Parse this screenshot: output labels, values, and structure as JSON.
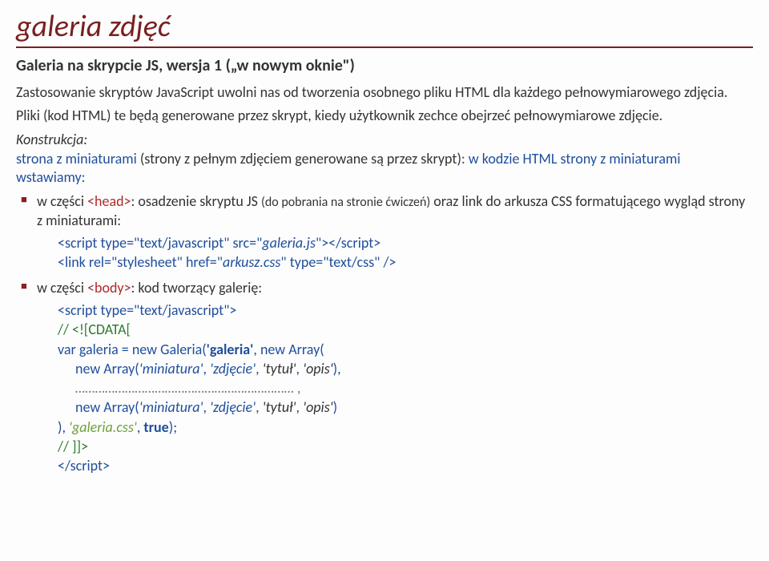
{
  "title": "galeria zdjęć",
  "subtitle": "Galeria na skrypcie JS, wersja 1 („w nowym oknie\")",
  "para1": "Zastosowanie skryptów JavaScript uwolni nas od tworzenia osobnego pliku HTML dla każdego pełnowymiarowego zdjęcia.",
  "para2": "Pliki (kod HTML) te będą generowane przez skrypt, kiedy użytkownik zechce obejrzeć pełnowymiarowe zdjęcie.",
  "konstrukcja": "Konstrukcja:",
  "strona_a": "strona z miniaturami ",
  "strona_b": "(strony z pełnym zdjęciem generowane są przez skrypt)",
  "strona_c": ": w kodzie HTML strony z miniaturami wstawiamy:",
  "li1_a": "w części ",
  "li1_head": "<head>",
  "li1_b": ": osadzenie skryptu JS ",
  "li1_paren": "(do pobrania na stronie ćwiczeń)",
  "li1_c": " oraz link do arkusza CSS formatującego wygląd strony z miniaturami:",
  "code1_a": "<script type=\"text/javascript\" src=\"",
  "code1_src": "galeria.js",
  "code1_b": "\"></scr",
  "code1_c": "ipt>",
  "code2_a": "<link rel=\"stylesheet\" href=\"",
  "code2_href": "arkusz.css",
  "code2_b": "\" type=\"text/css\" />",
  "li2_a": "w części ",
  "li2_body": "<body>",
  "li2_b": ": kod tworzący galerię:",
  "c_open": "<script type=\"text/javascript\">",
  "c_cdata_open": "// <![CDATA[",
  "c_var": "var ",
  "c_galeria": "galeria",
  "c_eq": " = ",
  "c_new": "new ",
  "c_g2": "Galeria(",
  "c_gal": "'galeria'",
  "c_comma": ", ",
  "c_arr": "Array(",
  "c_min": "'miniatura'",
  "c_zdj": "'zdjęcie'",
  "c_tytul": "'tytuł'",
  "c_opis": "'opis'",
  "c_close_paren_c": "),",
  "c_dots": "………………………………………………………… ,",
  "c_close_paren": ")",
  "c_tail_a": "), ",
  "c_css": "'galeria.css'",
  "c_tail_b": ", ",
  "c_true": "true",
  "c_tail_c": ");",
  "c_cdata_close": "// ]]>",
  "c_script_close_a": "</scr",
  "c_script_close_b": "ipt>"
}
